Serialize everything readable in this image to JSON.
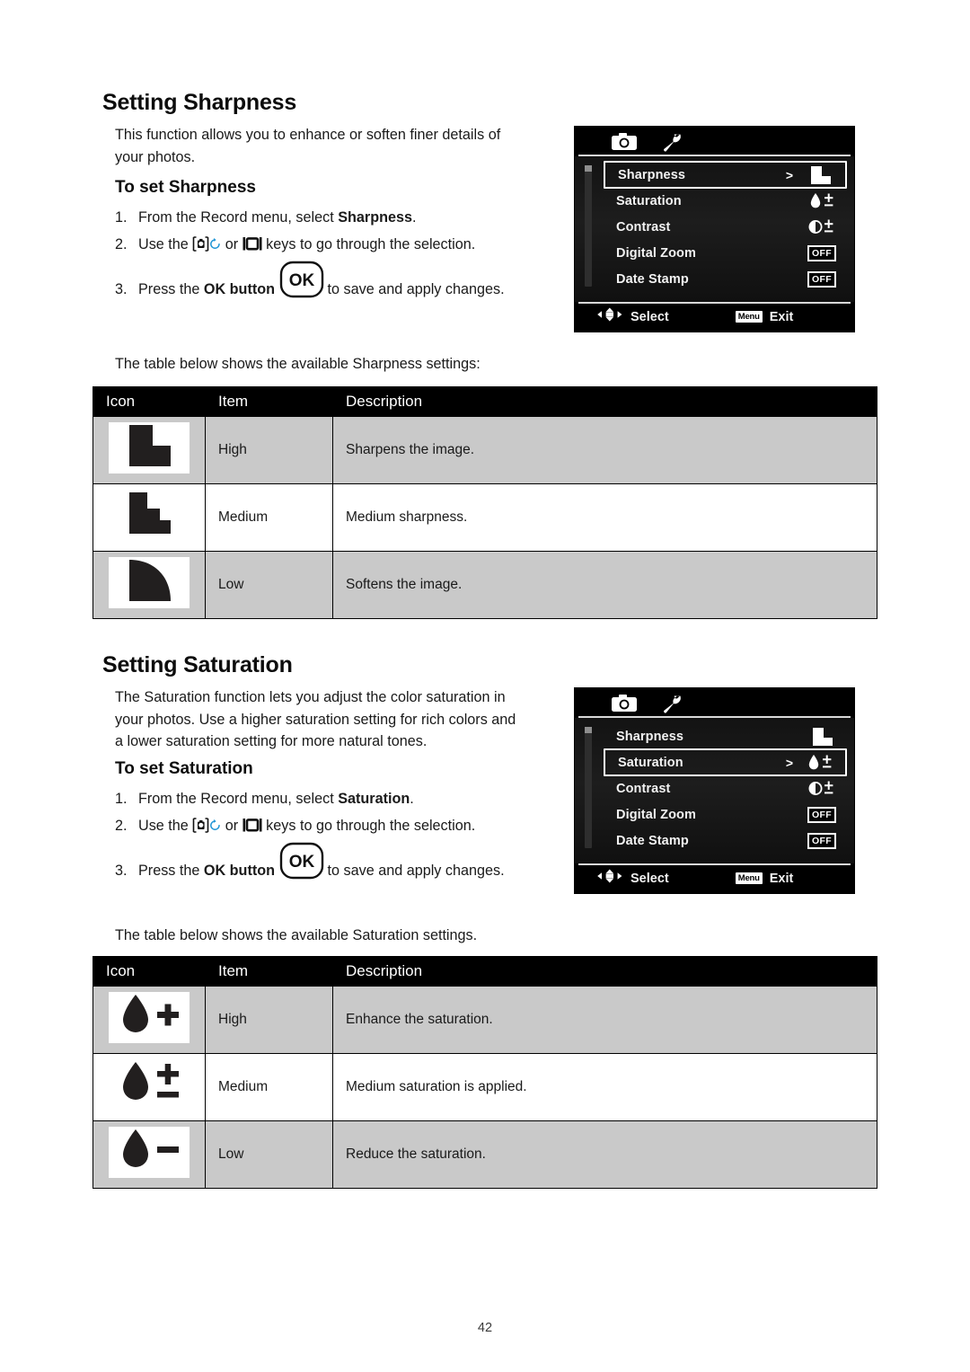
{
  "page": {
    "number": "42"
  },
  "sections": [
    {
      "title": "Setting Sharpness",
      "intro": "This function allows you to enhance or soften finer details of your photos.",
      "subtitle": "To set Sharpness",
      "steps": [
        {
          "num": "1.",
          "pre": "From the Record menu, select ",
          "bold": "Sharpness",
          "post": "."
        },
        {
          "num": "2.",
          "pre": "Use the ",
          "mid": " or ",
          "post": " keys to go through the selection."
        },
        {
          "num": "3.",
          "pre": "Press the ",
          "bold": "OK button",
          "post": " to save and apply changes."
        }
      ],
      "table_caption": "The table below shows the available Sharpness settings:",
      "table": {
        "headers": [
          "Icon",
          "Item",
          "Description"
        ],
        "rows": [
          {
            "icon": "sharpness-high-icon",
            "item": "High",
            "description": "Sharpens the image."
          },
          {
            "icon": "sharpness-medium-icon",
            "item": "Medium",
            "description": "Medium sharpness."
          },
          {
            "icon": "sharpness-low-icon",
            "item": "Low",
            "description": "Softens the image."
          }
        ]
      }
    },
    {
      "title": "Setting Saturation",
      "intro": "The Saturation function lets you adjust the color saturation in your photos. Use a higher saturation setting for rich colors and a lower saturation setting for more natural tones.",
      "subtitle": "To set Saturation",
      "steps": [
        {
          "num": "1.",
          "pre": "From the Record menu, select ",
          "bold": "Saturation",
          "post": "."
        },
        {
          "num": "2.",
          "pre": "Use the ",
          "mid": " or ",
          "post": " keys to go through the selection."
        },
        {
          "num": "3.",
          "pre": "Press the ",
          "bold": "OK button",
          "post": " to save and apply changes."
        }
      ],
      "table_caption": "The table below shows the available Saturation settings.",
      "table": {
        "headers": [
          "Icon",
          "Item",
          "Description"
        ],
        "rows": [
          {
            "icon": "saturation-high-icon",
            "item": "High",
            "description": "Enhance the saturation."
          },
          {
            "icon": "saturation-medium-icon",
            "item": "Medium",
            "description": "Medium saturation is applied."
          },
          {
            "icon": "saturation-low-icon",
            "item": "Low",
            "description": "Reduce the saturation."
          }
        ]
      }
    }
  ],
  "lcd_screens": [
    {
      "tabs": [
        "camera-icon",
        "wrench-icon"
      ],
      "selected_item": "Sharpness",
      "items": [
        {
          "label": "Sharpness",
          "value_icon": "sharpness-step-icon",
          "value_text": "",
          "selected": true,
          "chevron": ">"
        },
        {
          "label": "Saturation",
          "value_icon": "droplet-plusminus-icon",
          "value_text": "",
          "selected": false,
          "chevron": ""
        },
        {
          "label": "Contrast",
          "value_icon": "contrast-plusminus-icon",
          "value_text": "",
          "selected": false,
          "chevron": ""
        },
        {
          "label": "Digital Zoom",
          "value_icon": "off-badge",
          "value_text": "OFF",
          "selected": false,
          "chevron": ""
        },
        {
          "label": "Date Stamp",
          "value_icon": "off-badge",
          "value_text": "OFF",
          "selected": false,
          "chevron": ""
        }
      ],
      "footer": {
        "select_label": "Select",
        "menu_badge": "Menu",
        "exit_label": "Exit"
      }
    },
    {
      "tabs": [
        "camera-icon",
        "wrench-icon"
      ],
      "selected_item": "Saturation",
      "items": [
        {
          "label": "Sharpness",
          "value_icon": "sharpness-step-icon",
          "value_text": "",
          "selected": false,
          "chevron": ""
        },
        {
          "label": "Saturation",
          "value_icon": "droplet-plusminus-icon",
          "value_text": "",
          "selected": true,
          "chevron": ">"
        },
        {
          "label": "Contrast",
          "value_icon": "contrast-plusminus-icon",
          "value_text": "",
          "selected": false,
          "chevron": ""
        },
        {
          "label": "Digital Zoom",
          "value_icon": "off-badge",
          "value_text": "OFF",
          "selected": false,
          "chevron": ""
        },
        {
          "label": "Date Stamp",
          "value_icon": "off-badge",
          "value_text": "OFF",
          "selected": false,
          "chevron": ""
        }
      ],
      "footer": {
        "select_label": "Select",
        "menu_badge": "Menu",
        "exit_label": "Exit"
      }
    }
  ],
  "ok_button_label": "OK",
  "colors": {
    "table_header_bg": "#000000",
    "table_shade_bg": "#c9c9c9",
    "lcd_bg": "#000000",
    "timer_icon_blue": "#2196d6"
  }
}
